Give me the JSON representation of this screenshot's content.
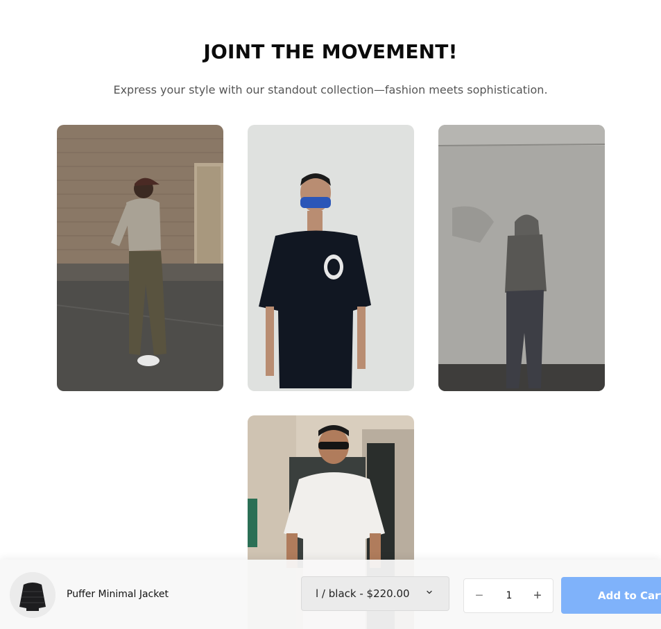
{
  "hero": {
    "title": "JOINT THE MOVEMENT!",
    "subtitle": "Express your style with our standout collection—fashion meets sophistication."
  },
  "gallery": {
    "photos": [
      {
        "icon": "man-brick-wall-photo"
      },
      {
        "icon": "woman-black-tee-photo"
      },
      {
        "icon": "hooded-figure-concrete-photo"
      },
      {
        "icon": "man-white-tee-photo"
      }
    ]
  },
  "sticky_cart": {
    "product_name": "Puffer Minimal Jacket",
    "thumbnail_icon": "puffer-jacket-thumbnail",
    "variant_selected": "l / black - $220.00",
    "quantity": "1",
    "minus_label": "−",
    "plus_label": "+",
    "add_to_cart_label": "Add to Cart",
    "accent_color": "#7fb2fa"
  }
}
